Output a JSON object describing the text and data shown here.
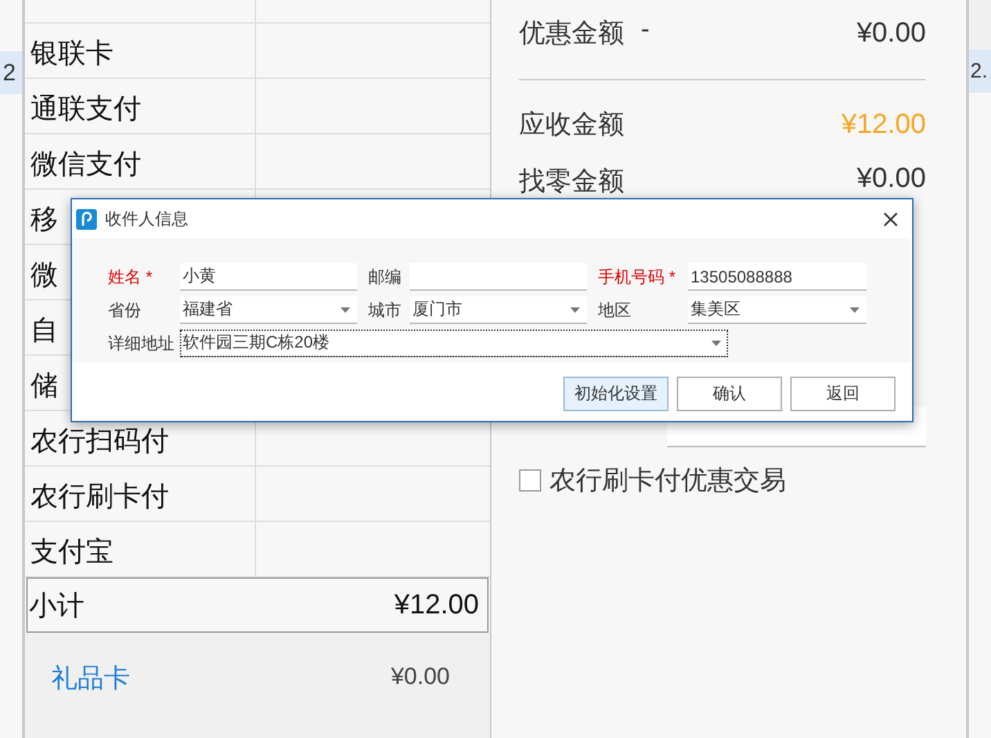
{
  "background_window": {
    "left_fragment": "2",
    "right_fragment": "2."
  },
  "payments": {
    "rows": [
      {
        "method": "银联卡"
      },
      {
        "method": "通联支付"
      },
      {
        "method": "微信支付"
      },
      {
        "method": "移"
      },
      {
        "method": "微"
      },
      {
        "method": "自"
      },
      {
        "method": "储"
      },
      {
        "method": "农行扫码付"
      },
      {
        "method": "农行刷卡付"
      },
      {
        "method": "支付宝"
      }
    ],
    "subtotal": {
      "label": "小计",
      "amount": "¥12.00"
    },
    "gift_card": {
      "label": "礼品卡",
      "amount": "¥0.00"
    }
  },
  "summary": {
    "rows": [
      {
        "label": "优惠金额",
        "sign": "-",
        "amount": "¥0.00",
        "highlight": false
      },
      {
        "label": "应收金额",
        "amount": "¥12.00",
        "highlight": true
      },
      {
        "label": "找零金额",
        "amount": "¥0.00",
        "highlight": false
      }
    ],
    "checkbox": {
      "label": "农行刷卡付优惠交易",
      "checked": false
    }
  },
  "dialog": {
    "title": "收件人信息",
    "fields": [
      {
        "label": "姓名 *",
        "required": true,
        "kind": "text",
        "value": "小黄"
      },
      {
        "label": "邮编",
        "required": false,
        "kind": "text"
      },
      {
        "label": "手机号码 *",
        "required": true,
        "kind": "text",
        "value": "13505088888"
      },
      {
        "label": "省份",
        "required": false,
        "kind": "select",
        "value": "福建省"
      },
      {
        "label": "城市",
        "required": false,
        "kind": "select",
        "value": "厦门市"
      },
      {
        "label": "地区",
        "required": false,
        "kind": "select",
        "value": "集美区"
      },
      {
        "label": "详细地址",
        "required": false,
        "kind": "combo",
        "value": "软件园三期C栋20楼",
        "focused": true
      }
    ],
    "buttons": [
      {
        "label": "初始化设置",
        "default": true
      },
      {
        "label": "确认",
        "default": false
      },
      {
        "label": "返回",
        "default": false
      }
    ]
  }
}
